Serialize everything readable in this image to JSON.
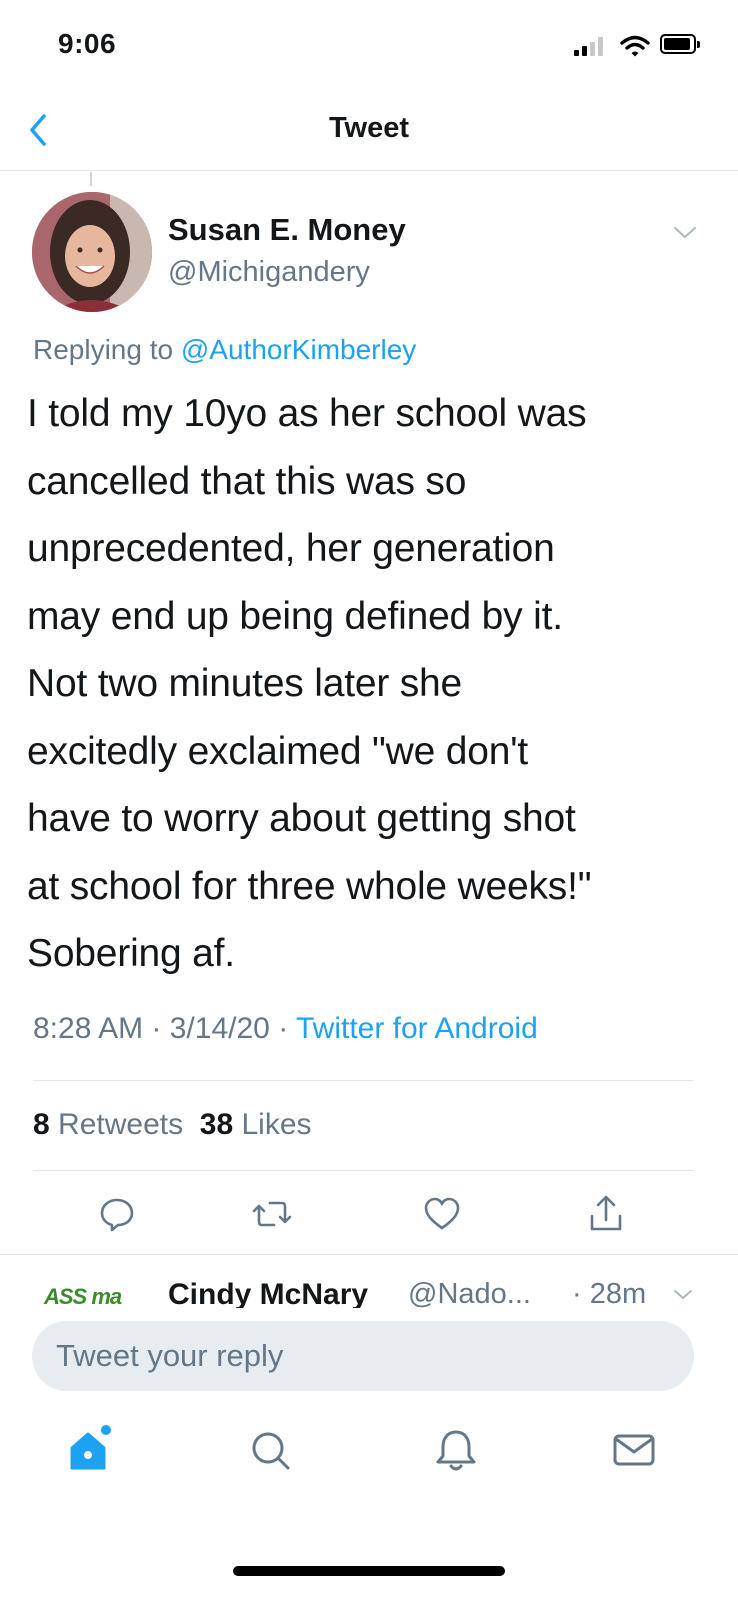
{
  "status_bar": {
    "time": "9:06"
  },
  "nav": {
    "title": "Tweet"
  },
  "tweet": {
    "author_name": "Susan E. Money",
    "author_handle": "@Michigandery",
    "replying_prefix": "Replying to ",
    "replying_to": "@AuthorKimberley",
    "text": "I told my 10yo as her school was\ncancelled that this was so\nunprecedented, her generation\nmay end up being defined by it.\nNot two minutes later she\nexcitedly exclaimed \"we don't\nhave to worry about getting shot\nat school for three whole weeks!\"\nSobering af.",
    "time": "8:28 AM",
    "date": "3/14/20",
    "source": "Twitter for Android",
    "retweets_count": "8",
    "retweets_label": "Retweets",
    "likes_count": "38",
    "likes_label": "Likes"
  },
  "actions": [
    "reply-icon",
    "retweet-icon",
    "like-icon",
    "share-icon"
  ],
  "reply_preview": {
    "logo_text": "ASS ma",
    "name": "Cindy McNary",
    "handle": "@Nado...",
    "time": "· 28m"
  },
  "reply_box": {
    "placeholder": "Tweet your reply"
  },
  "tab_bar": [
    "home-icon",
    "search-icon",
    "notifications-icon",
    "messages-icon"
  ],
  "colors": {
    "accent": "#1da1f2",
    "secondary_text": "#657786",
    "divider": "#e1e8ed"
  }
}
